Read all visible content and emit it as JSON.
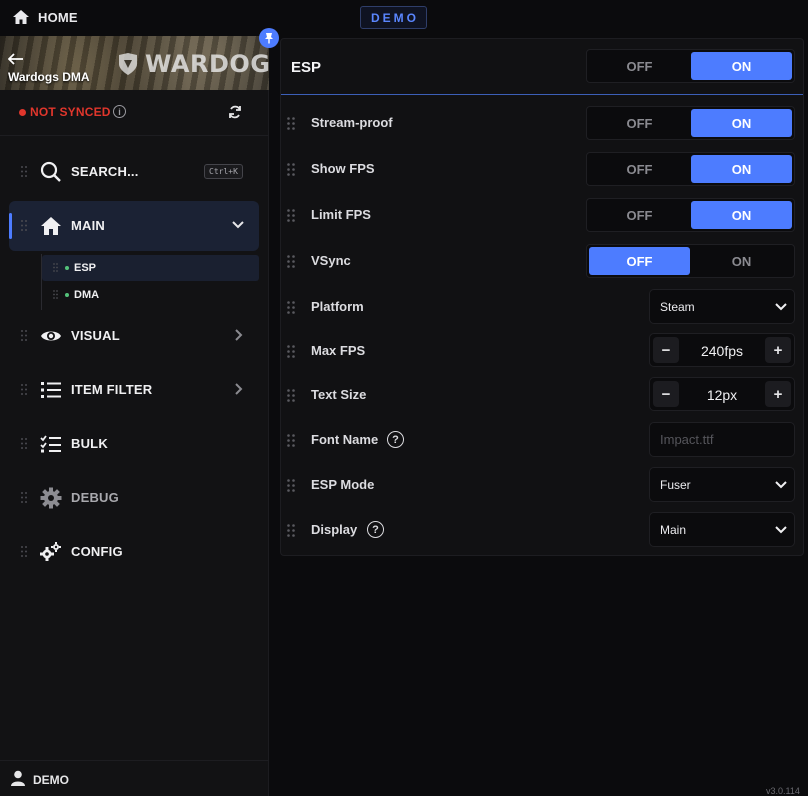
{
  "topbar": {
    "home_label": "HOME",
    "demo_badge": "DEMO"
  },
  "sidebar": {
    "banner_title": "Wardogs DMA",
    "banner_logo": "WARDOGS",
    "sync_status": "NOT SYNCED",
    "search_label": "SEARCH...",
    "search_shortcut": "Ctrl+K",
    "items": [
      {
        "label": "MAIN",
        "icon": "home-icon"
      },
      {
        "label": "VISUAL",
        "icon": "eye-icon"
      },
      {
        "label": "ITEM FILTER",
        "icon": "list-icon"
      },
      {
        "label": "BULK",
        "icon": "checklist-icon"
      },
      {
        "label": "DEBUG",
        "icon": "gear-icon"
      },
      {
        "label": "CONFIG",
        "icon": "gears-icon"
      }
    ],
    "main_subitems": [
      {
        "label": "ESP"
      },
      {
        "label": "DMA"
      }
    ],
    "footer_user": "DEMO"
  },
  "panel": {
    "title": "ESP",
    "off_label": "OFF",
    "on_label": "ON",
    "header_toggle": "on",
    "rows": {
      "stream_proof": {
        "label": "Stream-proof",
        "value": "on"
      },
      "show_fps": {
        "label": "Show FPS",
        "value": "on"
      },
      "limit_fps": {
        "label": "Limit FPS",
        "value": "on"
      },
      "vsync": {
        "label": "VSync",
        "value": "off"
      },
      "platform": {
        "label": "Platform",
        "value": "Steam"
      },
      "max_fps": {
        "label": "Max FPS",
        "value": "240fps"
      },
      "text_size": {
        "label": "Text Size",
        "value": "12px"
      },
      "font_name": {
        "label": "Font Name",
        "placeholder": "Impact.ttf"
      },
      "esp_mode": {
        "label": "ESP Mode",
        "value": "Fuser"
      },
      "display": {
        "label": "Display",
        "value": "Main"
      }
    },
    "help_glyph": "?",
    "minus_glyph": "−",
    "plus_glyph": "+"
  },
  "version": "v3.0.114",
  "colors": {
    "accent": "#4d7cff",
    "danger": "#e0362c",
    "success": "#54c27a",
    "background": "#0b0b0d"
  }
}
